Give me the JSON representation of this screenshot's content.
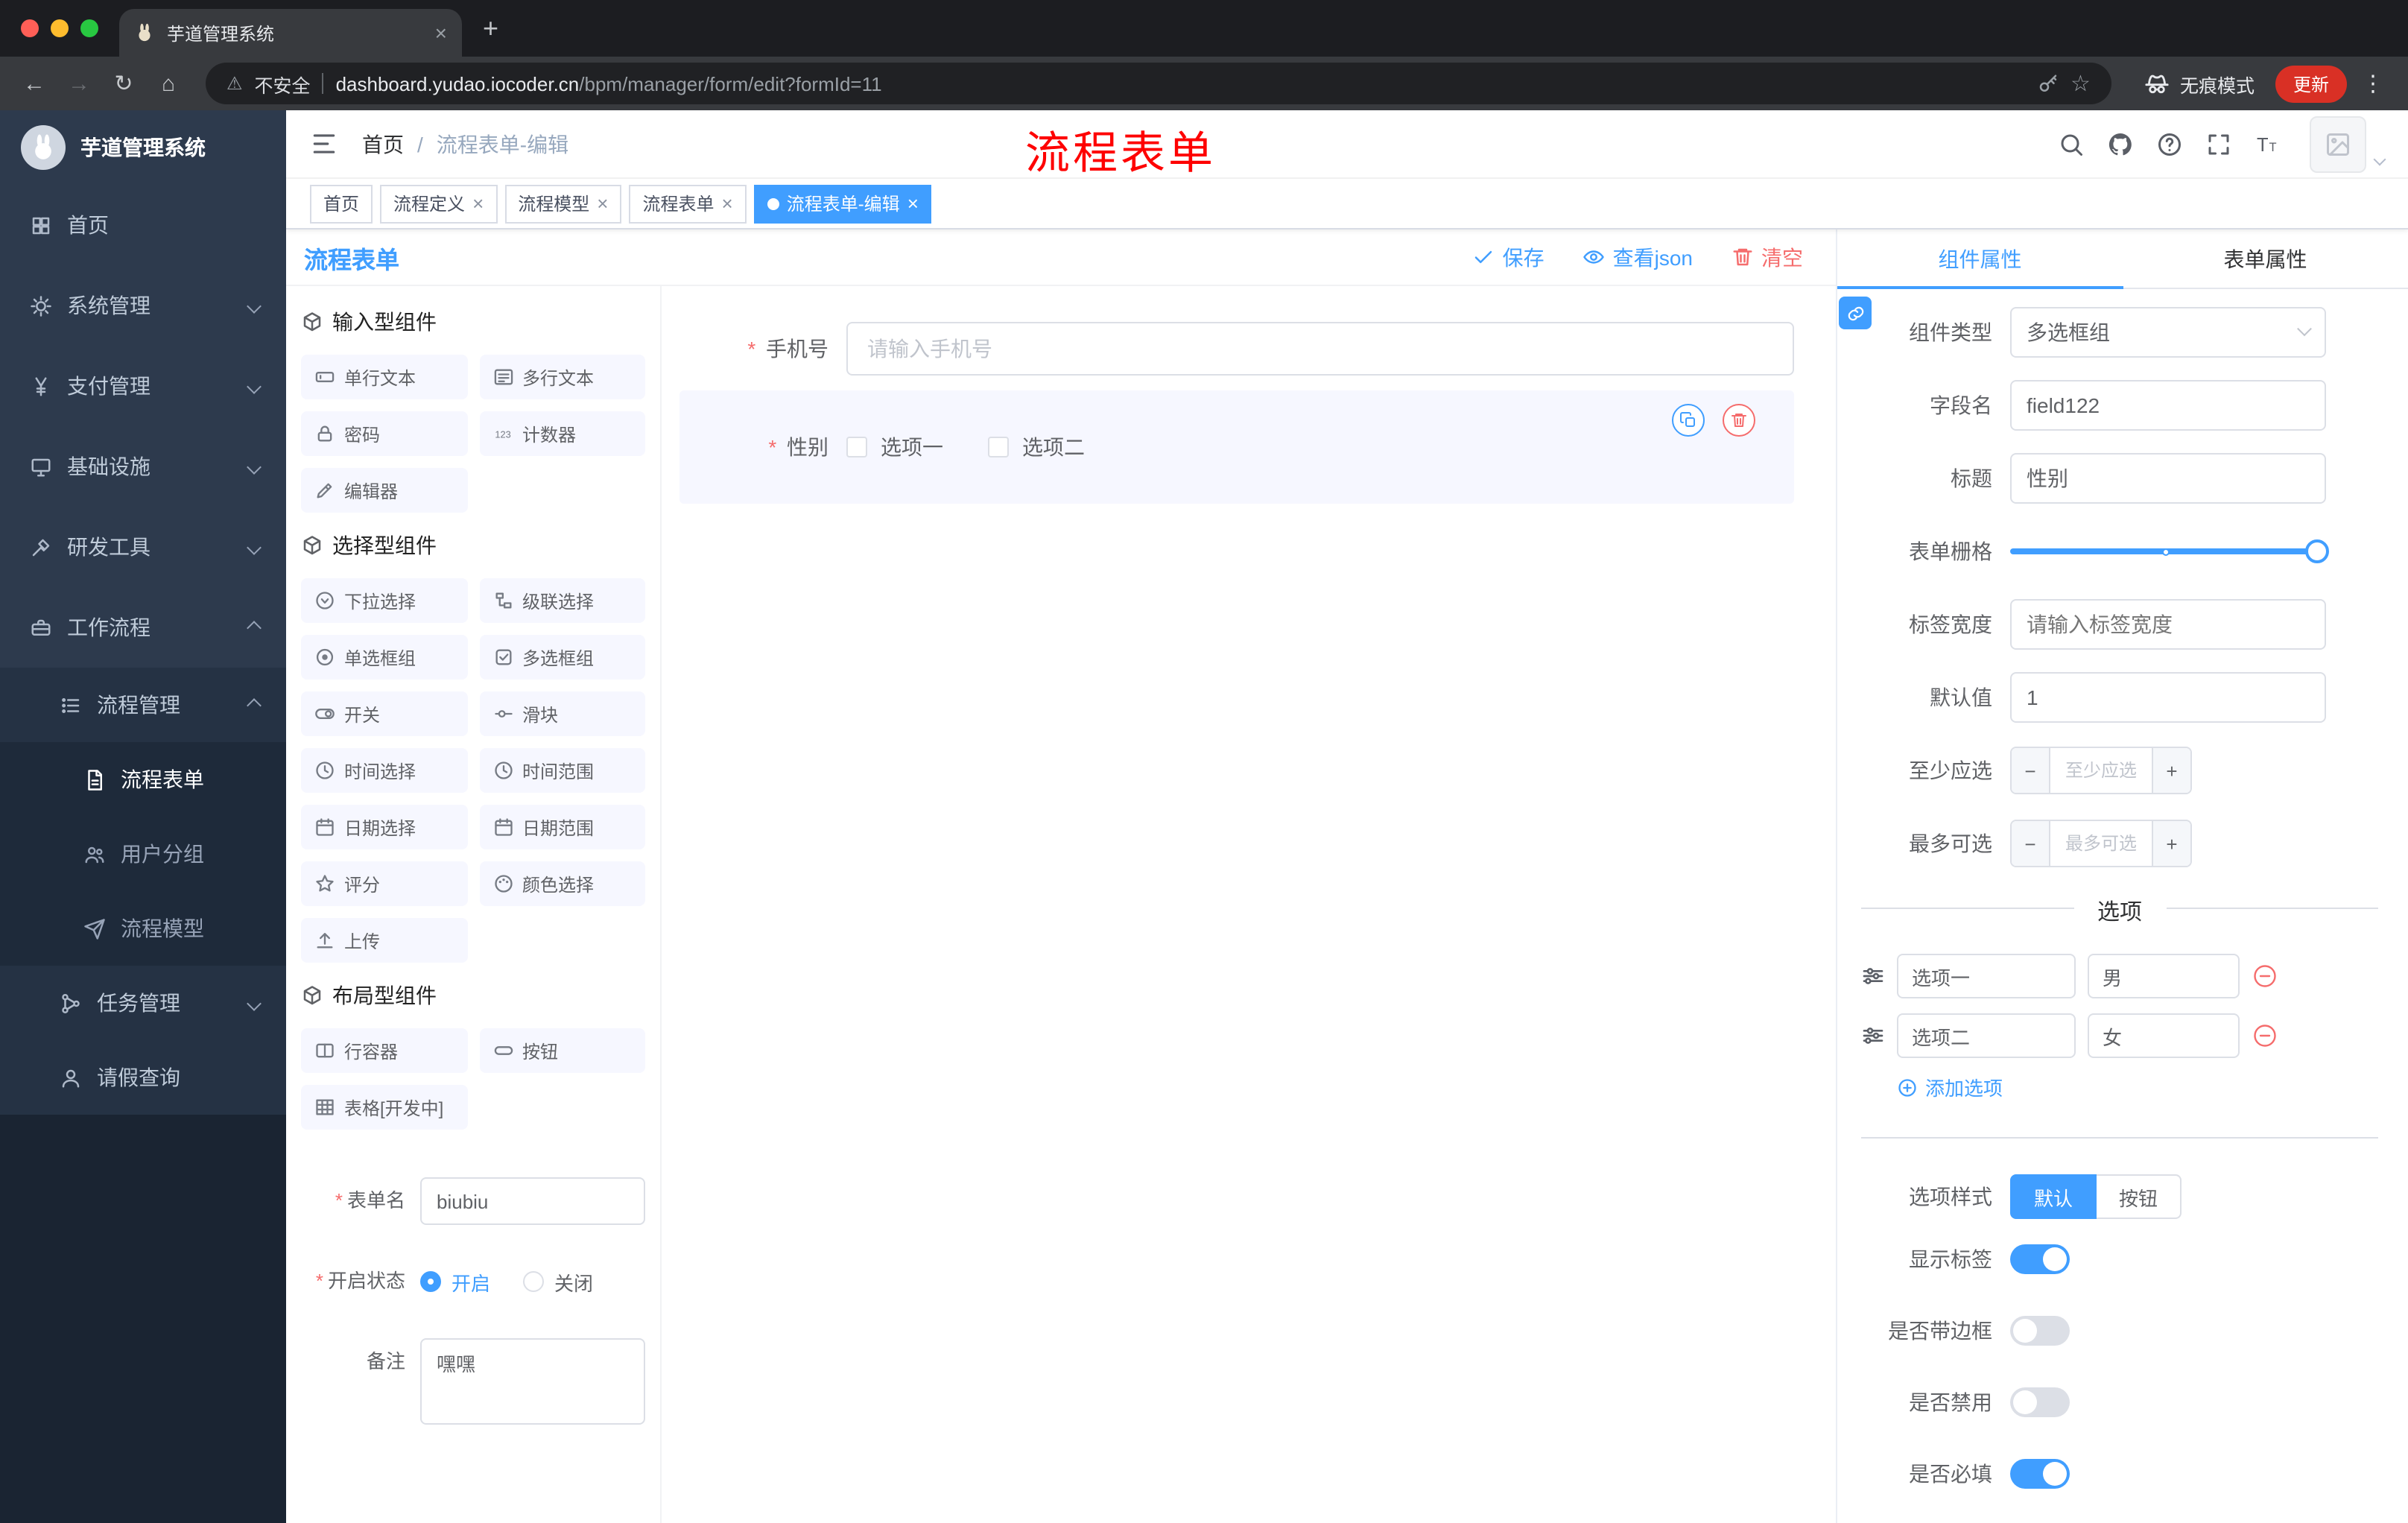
{
  "icons": {
    "back": "←",
    "forward": "→",
    "reload": "↻",
    "home": "⌂",
    "warning": "⚠",
    "menu_dots": "⋮",
    "close": "×",
    "new_tab": "+",
    "minus": "−",
    "plus": "+",
    "asterisk": "*",
    "slash": "/"
  },
  "browser": {
    "tab_title": "芋道管理系统",
    "security": "不安全",
    "domain": "dashboard.yudao.iocoder.cn",
    "path": "/bpm/manager/form/edit?formId=11",
    "incognito": "无痕模式",
    "update": "更新"
  },
  "sidebar": {
    "logo": "芋道管理系统",
    "items": {
      "home": "首页",
      "system": "系统管理",
      "pay": "支付管理",
      "infra": "基础设施",
      "dev": "研发工具",
      "workflow": "工作流程",
      "process": "流程管理",
      "form": "流程表单",
      "group": "用户分组",
      "model": "流程模型",
      "task": "任务管理",
      "leave": "请假查询"
    }
  },
  "header": {
    "breadcrumb_home": "首页",
    "breadcrumb_current": "流程表单-编辑",
    "annotation": "流程表单"
  },
  "tags": [
    {
      "label": "首页",
      "active": false
    },
    {
      "label": "流程定义",
      "active": false
    },
    {
      "label": "流程模型",
      "active": false
    },
    {
      "label": "流程表单",
      "active": false
    },
    {
      "label": "流程表单-编辑",
      "active": true
    }
  ],
  "palette": {
    "title": "流程表单",
    "groups": [
      {
        "title": "输入型组件",
        "items": [
          {
            "label": "单行文本",
            "icon": "input-icon"
          },
          {
            "label": "多行文本",
            "icon": "textarea-icon"
          },
          {
            "label": "密码",
            "icon": "lock-icon"
          },
          {
            "label": "计数器",
            "icon": "counter-icon"
          },
          {
            "label": "编辑器",
            "icon": "pencil-icon"
          }
        ]
      },
      {
        "title": "选择型组件",
        "items": [
          {
            "label": "下拉选择",
            "icon": "select-icon"
          },
          {
            "label": "级联选择",
            "icon": "cascader-icon"
          },
          {
            "label": "单选框组",
            "icon": "radio-icon"
          },
          {
            "label": "多选框组",
            "icon": "checkbox-icon"
          },
          {
            "label": "开关",
            "icon": "switch-icon"
          },
          {
            "label": "滑块",
            "icon": "slider-icon"
          },
          {
            "label": "时间选择",
            "icon": "time-icon"
          },
          {
            "label": "时间范围",
            "icon": "time-range-icon"
          },
          {
            "label": "日期选择",
            "icon": "date-icon"
          },
          {
            "label": "日期范围",
            "icon": "date-range-icon"
          },
          {
            "label": "评分",
            "icon": "star-icon"
          },
          {
            "label": "颜色选择",
            "icon": "color-icon"
          },
          {
            "label": "上传",
            "icon": "upload-icon"
          }
        ]
      },
      {
        "title": "布局型组件",
        "items": [
          {
            "label": "行容器",
            "icon": "row-icon"
          },
          {
            "label": "按钮",
            "icon": "button-icon"
          },
          {
            "label": "表格[开发中]",
            "icon": "table-icon"
          }
        ]
      }
    ],
    "form": {
      "name_label": "表单名",
      "name_value": "biubiu",
      "status_label": "开启状态",
      "status_on": "开启",
      "status_off": "关闭",
      "remark_label": "备注",
      "remark_value": "嘿嘿"
    }
  },
  "canvas": {
    "save": "保存",
    "view_json": "查看json",
    "clear": "清空",
    "phone_label": "手机号",
    "phone_placeholder": "请输入手机号",
    "gender_label": "性别",
    "gender_opt1": "选项一",
    "gender_opt2": "选项二"
  },
  "inspector": {
    "tab_component": "组件属性",
    "tab_form": "表单属性",
    "type_label": "组件类型",
    "type_value": "多选框组",
    "field_label": "字段名",
    "field_value": "field122",
    "title_label": "标题",
    "title_value": "性别",
    "grid_label": "表单栅格",
    "width_label": "标签宽度",
    "width_placeholder": "请输入标签宽度",
    "default_label": "默认值",
    "default_value": "1",
    "min_label": "至少应选",
    "min_placeholder": "至少应选",
    "max_label": "最多可选",
    "max_placeholder": "最多可选",
    "options_title": "选项",
    "options": [
      {
        "label": "选项一",
        "value": "男"
      },
      {
        "label": "选项二",
        "value": "女"
      }
    ],
    "add_option": "添加选项",
    "style_label": "选项样式",
    "style_default": "默认",
    "style_button": "按钮",
    "switches": [
      {
        "label": "显示标签",
        "on": true
      },
      {
        "label": "是否带边框",
        "on": false
      },
      {
        "label": "是否禁用",
        "on": false
      },
      {
        "label": "是否必填",
        "on": true
      }
    ]
  }
}
